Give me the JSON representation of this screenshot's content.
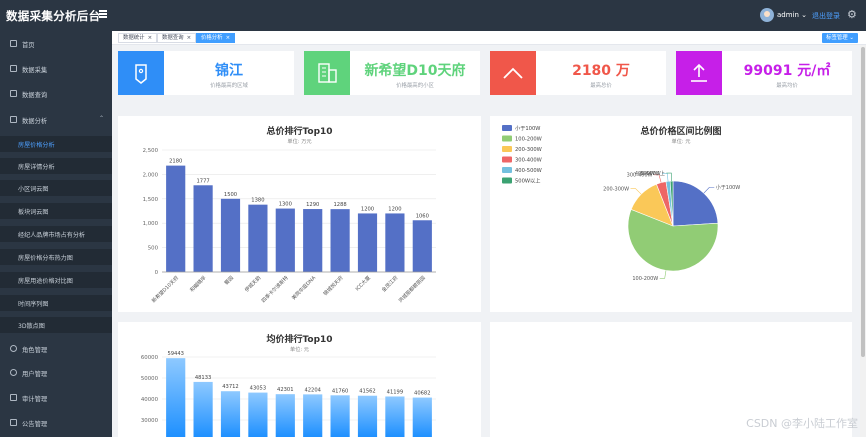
{
  "app": {
    "title": "数据采集分析后台"
  },
  "header": {
    "username": "admin",
    "logout_label": "退出登录"
  },
  "sidebar": {
    "items": [
      {
        "label": "首页",
        "icon": "monitor-icon"
      },
      {
        "label": "数据采集",
        "icon": "collect-icon"
      },
      {
        "label": "数据查询",
        "icon": "send-icon"
      },
      {
        "label": "数据分析",
        "icon": "analysis-icon"
      },
      {
        "label": "角色管理",
        "icon": "gear-icon"
      },
      {
        "label": "用户管理",
        "icon": "user-icon"
      },
      {
        "label": "审计管理",
        "icon": "audit-icon"
      },
      {
        "label": "公告管理",
        "icon": "notice-icon"
      }
    ],
    "analysis_submenu": [
      "房屋价格分析",
      "房屋详情分析",
      "小区词云图",
      "板块词云图",
      "经纪人品牌市场占有分析",
      "房屋价格分布热力图",
      "房屋用途价格对比图",
      "时间序列图",
      "3D散点图"
    ]
  },
  "tags": [
    {
      "label": "数据统计",
      "active": false
    },
    {
      "label": "数据查询",
      "active": false
    },
    {
      "label": "价格分析",
      "active": true
    }
  ],
  "tags_button": "标签管理",
  "stats": [
    {
      "value": "锦江",
      "sub": "价格最高的区域",
      "color": "#2f8ef7",
      "value_color": "#2f8ef7",
      "icon": "location-tag-icon"
    },
    {
      "value": "新希望D10天府",
      "sub": "价格最高的小区",
      "color": "#5fd37c",
      "value_color": "#5fd37c",
      "icon": "building-icon"
    },
    {
      "value": "2180 万",
      "sub": "最高总价",
      "color": "#f0574a",
      "value_color": "#f0574a",
      "icon": "arrow-up-icon"
    },
    {
      "value": "99091 元/㎡",
      "sub": "最高均价",
      "color": "#c61fe8",
      "value_color": "#c61fe8",
      "icon": "upload-icon"
    }
  ],
  "total_price_chart": {
    "title": "总价排行Top10",
    "unit": "单位: 万元",
    "chart_data": {
      "type": "bar",
      "categories": [
        "新希望D10天府",
        "和樾晴岸",
        "蜀园",
        "伊城天韵",
        "四季卡尔波斯特",
        "美院华庭DNA",
        "锦城悦天府",
        "ICC大厦",
        "金茂江府",
        "洪城丽都碧丽园"
      ],
      "values": [
        2180,
        1777,
        1500,
        1380,
        1300,
        1290,
        1288,
        1200,
        1200,
        1060
      ],
      "ylim": [
        0,
        2500
      ],
      "yticks": [
        "0",
        "500",
        "1,000",
        "1,500",
        "2,000",
        "2,500"
      ],
      "color": "#5470c6"
    }
  },
  "avg_price_chart": {
    "title": "均价排行Top10",
    "unit": "单位: 元",
    "chart_data": {
      "type": "bar",
      "values": [
        59443,
        48133,
        43712,
        43053,
        42301,
        42204,
        41760,
        41562,
        41199,
        40682
      ],
      "yticks": [
        "30000",
        "40000",
        "50000",
        "60000"
      ],
      "color": "#1e90ff"
    }
  },
  "price_range_chart": {
    "title": "总价价格区间比例图",
    "unit": "单位: 元",
    "chart_data": {
      "type": "pie",
      "legend_placement": "top-left",
      "series": [
        {
          "name": "小于100W",
          "value": 24,
          "color": "#5470c6"
        },
        {
          "name": "100-200W",
          "value": 57,
          "color": "#91cc75"
        },
        {
          "name": "200-300W",
          "value": 13,
          "color": "#fac858"
        },
        {
          "name": "300-400W",
          "value": 3.5,
          "color": "#ee6666"
        },
        {
          "name": "400-500W",
          "value": 1.5,
          "color": "#73c0de"
        },
        {
          "name": "500W以上",
          "value": 1,
          "color": "#3ba272"
        }
      ]
    }
  },
  "watermark": "CSDN @李小陆工作室"
}
